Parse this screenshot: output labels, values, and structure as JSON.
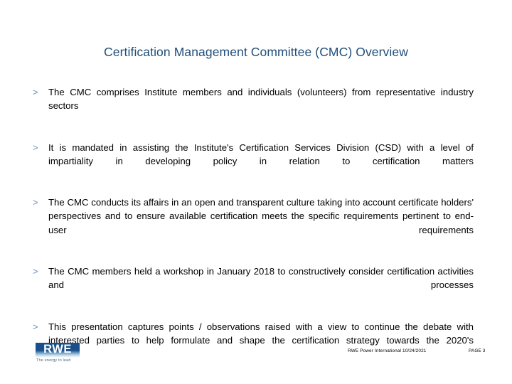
{
  "slide": {
    "title": "Certification Management Committee (CMC) Overview",
    "bullet_marker": ">",
    "bullets": [
      {
        "text": "The CMC comprises Institute members and individuals (volunteers) from representative industry sectors"
      },
      {
        "text": "It is mandated in assisting the Institute's Certification Services Division (CSD) with a level of impartiality in developing policy in relation to certification matters"
      },
      {
        "text": "The CMC conducts its affairs in an open and transparent culture taking into account certificate holders' perspectives and to ensure available certification meets the specific requirements pertinent to end-user requirements"
      },
      {
        "text": "The CMC members held a workshop in January 2018 to constructively consider certification activities and processes"
      },
      {
        "text": "This presentation captures points / observations raised with a view to continue the debate with interested parties to help formulate and shape the certification strategy towards the 2020's"
      }
    ]
  },
  "footer": {
    "logo_text": "RWE",
    "logo_tagline": "The energy to lead",
    "meta": "RWE Power International   10/24/2021",
    "page_label": "PAGE 3"
  },
  "colors": {
    "title": "#1F4E79",
    "bullet_marker": "#6C8EBF",
    "body_text": "#000000",
    "logo_blue": "#1b4f8a",
    "background": "#ffffff"
  }
}
